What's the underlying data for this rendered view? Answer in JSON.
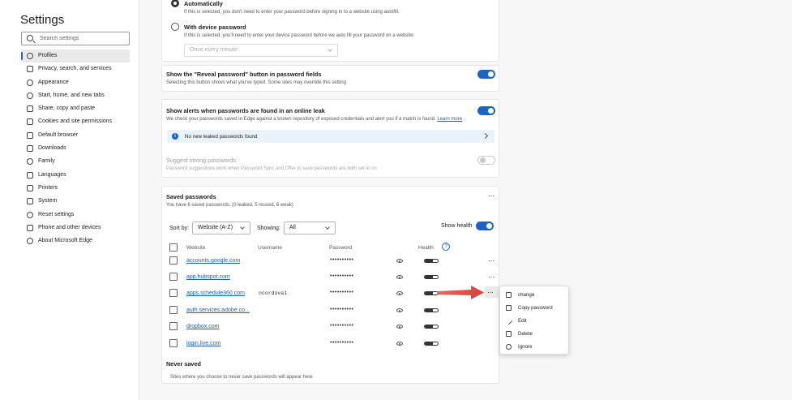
{
  "sidebar": {
    "title": "Settings",
    "search_placeholder": "Search settings",
    "items": [
      {
        "label": "Profiles",
        "icon": "profile-icon"
      },
      {
        "label": "Privacy, search, and services",
        "icon": "lock-icon"
      },
      {
        "label": "Appearance",
        "icon": "appearance-icon"
      },
      {
        "label": "Start, home, and new tabs",
        "icon": "power-icon"
      },
      {
        "label": "Share, copy and paste",
        "icon": "share-icon"
      },
      {
        "label": "Cookies and site permissions",
        "icon": "cookie-icon"
      },
      {
        "label": "Default browser",
        "icon": "browser-icon"
      },
      {
        "label": "Downloads",
        "icon": "download-icon"
      },
      {
        "label": "Family",
        "icon": "family-icon"
      },
      {
        "label": "Languages",
        "icon": "languages-icon"
      },
      {
        "label": "Printers",
        "icon": "printer-icon"
      },
      {
        "label": "System",
        "icon": "system-icon"
      },
      {
        "label": "Reset settings",
        "icon": "reset-icon"
      },
      {
        "label": "Phone and other devices",
        "icon": "phone-icon"
      },
      {
        "label": "About Microsoft Edge",
        "icon": "edge-icon"
      }
    ]
  },
  "autofill": {
    "auto_label": "Automatically",
    "auto_desc": "If this is selected, you don't need to enter your password before signing in to a website using autofill.",
    "device_label": "With device password",
    "device_desc": "If this is selected, you'll need to enter your device password before we auto fill your password on a website.",
    "interval_value": "Once every minute"
  },
  "reveal": {
    "title": "Show the \"Reveal password\" button in password fields",
    "desc": "Selecting this button shows what you've typed. Some sites may override this setting"
  },
  "alerts": {
    "title": "Show alerts when passwords are found in an online leak",
    "desc": "We check your passwords saved in Edge against a known repository of exposed credentials and alert you if a match is found.",
    "learn_more": "Learn more",
    "info_text": "No new leaked passwords found",
    "suggest_title": "Suggest strong passwords",
    "suggest_desc": "Password suggestions work when Password Sync and Offer to save passwords are both set to on"
  },
  "saved": {
    "title": "Saved passwords",
    "summary": "You have 6 saved passwords. (0 leaked, 5 reused, 6 weak)",
    "sort_label": "Sort by:",
    "sort_value": "Website (A-Z)",
    "showing_label": "Showing:",
    "showing_value": "All",
    "show_health_label": "Show health",
    "columns": {
      "website": "Website",
      "username": "Username",
      "password": "Password",
      "health": "Health"
    },
    "rows": [
      {
        "site": "accounts.google.com",
        "user": "",
        "pass": "••••••••••"
      },
      {
        "site": "app.hubspot.com",
        "user": "",
        "pass": "••••••••••"
      },
      {
        "site": "apps.schedule360.com",
        "user": "ncordova1",
        "pass": "••••••••••"
      },
      {
        "site": "auth.services.adobe.co...",
        "user": "",
        "pass": "••••••••••"
      },
      {
        "site": "dropbox.com",
        "user": "",
        "pass": "••••••••••"
      },
      {
        "site": "login.live.com",
        "user": "",
        "pass": "••••••••••"
      }
    ],
    "never_saved_title": "Never saved",
    "never_saved_desc": "Sites where you choose to never save passwords will appear here"
  },
  "context_menu": {
    "items": [
      {
        "label": "change",
        "icon": "external-link-icon"
      },
      {
        "label": "Copy password",
        "icon": "copy-icon"
      },
      {
        "label": "Edit",
        "icon": "pencil-icon"
      },
      {
        "label": "Delete",
        "icon": "trash-icon"
      },
      {
        "label": "Ignore",
        "icon": "block-icon"
      }
    ]
  },
  "colors": {
    "accent": "#1a64c8",
    "annotation_arrow": "#d9413a"
  }
}
